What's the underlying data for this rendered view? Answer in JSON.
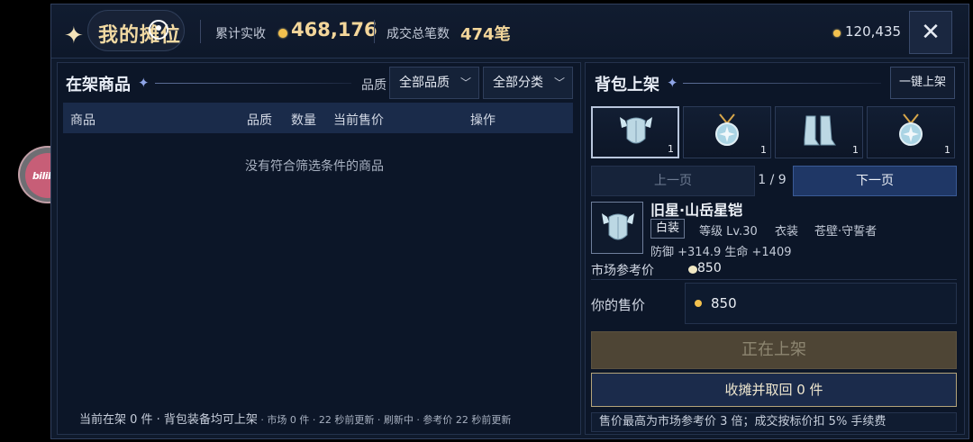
{
  "header": {
    "title": "我的摊位",
    "revenue_label": "累计实收",
    "revenue_value": "468,176",
    "trades_label": "成交总笔数",
    "trades_value": "474笔",
    "gold_value": "120,435",
    "close_icon": "close-icon"
  },
  "left": {
    "title": "在架商品",
    "quality_label": "品质",
    "quality_select": "全部品质",
    "category_select": "全部分类",
    "columns": [
      "商品",
      "品质",
      "数量",
      "当前售价",
      "操作"
    ],
    "empty_message": "没有符合筛选条件的商品",
    "footer_main": "当前在架 0 件 · 背包装备均可上架",
    "footer_small": " · 市场 0 件 · 22 秒前更新 · 刷新中 · 参考价 22 秒前更新"
  },
  "right": {
    "title": "背包上架",
    "one_key": "一键上架",
    "slots": [
      {
        "icon": "winged-armor-icon",
        "count": "1"
      },
      {
        "icon": "amulet-icon",
        "count": "1"
      },
      {
        "icon": "boots-icon",
        "count": "1"
      },
      {
        "icon": "amulet-icon",
        "count": "1"
      }
    ],
    "prev_page": "上一页",
    "page_indicator": "1 / 9",
    "next_page": "下一页",
    "item": {
      "name": "旧星·山岳星铠",
      "rarity": "白装",
      "level": "等级 Lv.30",
      "slot": "衣装",
      "faction": "苍壁·守誓者",
      "stats": "防御 +314.9   生命 +1409"
    },
    "ref_price_label": "市场参考价",
    "ref_price_value": "850",
    "your_price_label": "你的售价",
    "your_price_value": "850",
    "listing_button": "正在上架",
    "recall_button": "收摊并取回 0 件",
    "note": "售价最高为市场参考价 3 倍；成交按标价扣 5% 手续费"
  },
  "watermark": "bilibili",
  "colors": {
    "gold": "#f3c14e",
    "accent": "#1f3766",
    "title_gold": "#f1d9a2"
  }
}
